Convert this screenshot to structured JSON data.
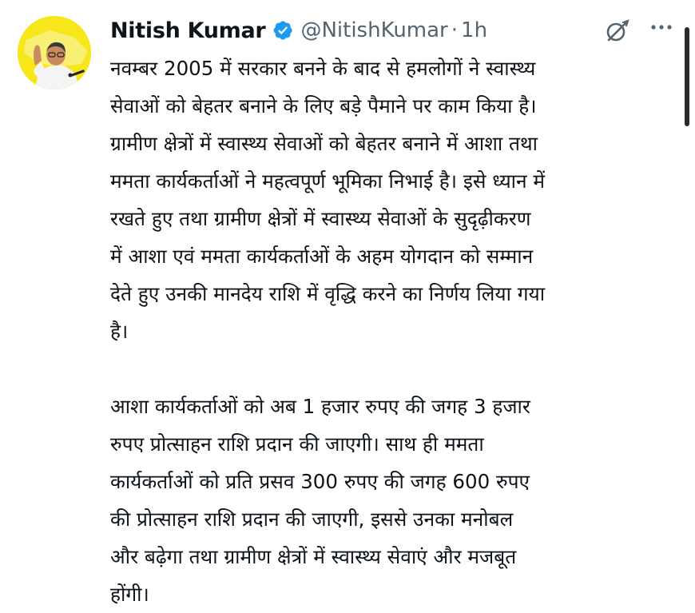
{
  "author": {
    "name": "Nitish Kumar",
    "handle": "@NitishKumar",
    "separator": "·",
    "time": "1h",
    "verified": true,
    "avatar": "avatar-photo"
  },
  "icons": {
    "verified": "verified-badge-icon",
    "grok": "grok-icon",
    "more": "more-options-icon"
  },
  "colors": {
    "verified_badge": "#1d9bf0",
    "text": "#0f1419",
    "secondary_text": "#536471",
    "avatar_bg": "#f6e61a"
  },
  "tweet": {
    "lines": [
      "नवम्बर 2005 में सरकार बनने के बाद से हमलोगों ने स्वास्थ्य",
      "सेवाओं को बेहतर बनाने के लिए बड़े पैमाने पर काम किया है।",
      "ग्रामीण क्षेत्रों में स्वास्थ्य सेवाओं को बेहतर बनाने में आशा तथा",
      "ममता कार्यकर्ताओं ने महत्वपूर्ण भूमिका निभाई है। इसे ध्यान में",
      "रखते हुए तथा ग्रामीण क्षेत्रों में स्वास्थ्य सेवाओं के सुदृढ़ीकरण",
      "में आशा एवं ममता कार्यकर्ताओं के अहम योगदान को सम्मान",
      "देते हुए उनकी मानदेय राशि में वृद्धि करने का निर्णय लिया गया",
      "है।",
      "",
      "आशा कार्यकर्ताओं को अब 1 हजार रुपए की जगह 3 हजार",
      "रुपए प्रोत्साहन राशि प्रदान की जाएगी। साथ ही ममता",
      "कार्यकर्ताओं को प्रति प्रसव 300 रुपए की जगह 600 रुपए",
      "की प्रोत्साहन राशि प्रदान की जाएगी, इससे उनका मनोबल",
      "और बढ़ेगा तथा ग्रामीण क्षेत्रों में स्वास्थ्य सेवाएं और मजबूत",
      "होंगी।"
    ]
  }
}
